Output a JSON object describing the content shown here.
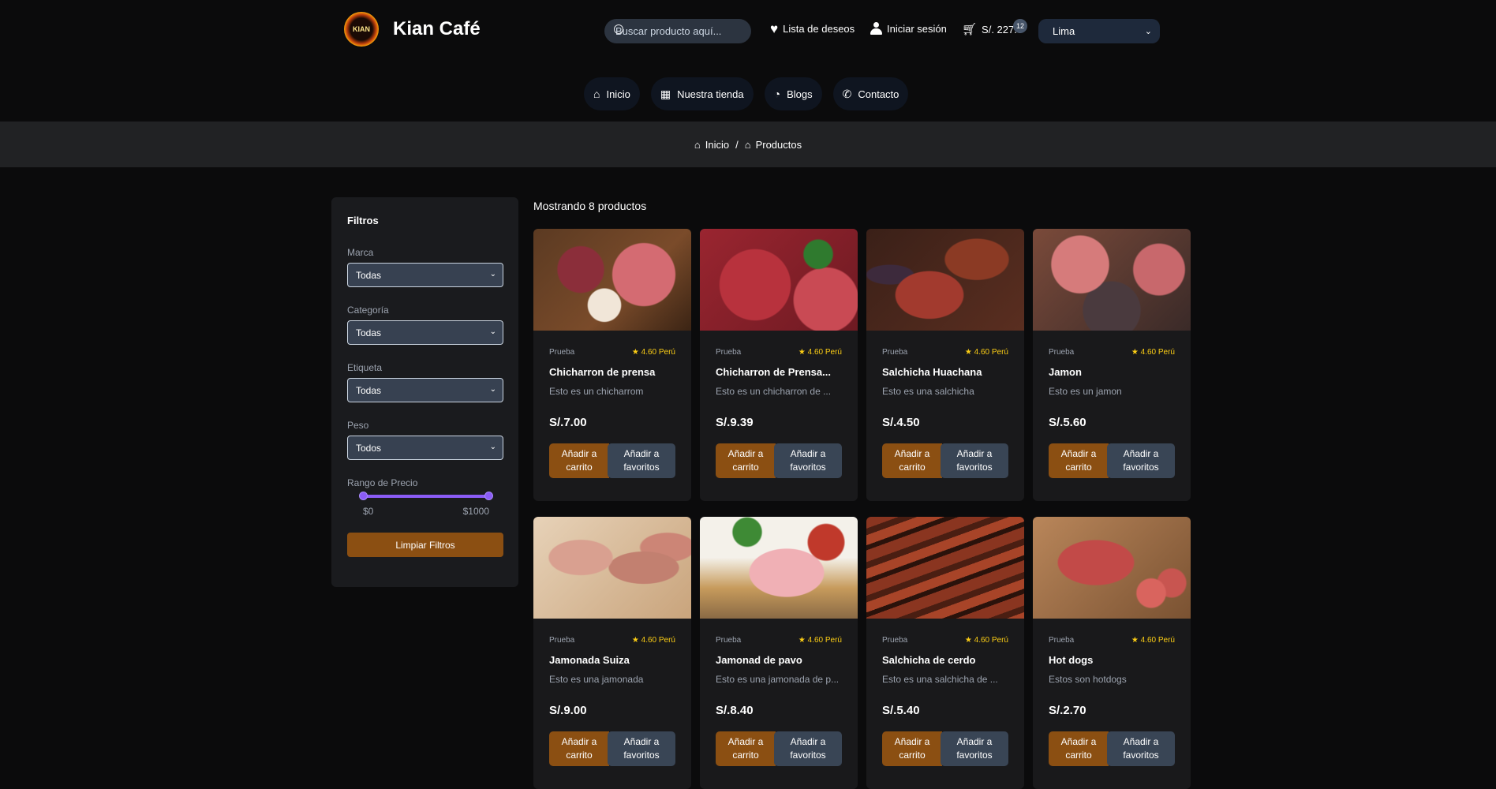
{
  "header": {
    "brand": "Kian Café",
    "logo_text": "KIAN",
    "search_placeholder": "Buscar producto aquí...",
    "wishlist_label": "Lista de deseos",
    "login_label": "Iniciar sesión",
    "cart_total": "S/. 227.0",
    "cart_count": "12",
    "city": "Lima"
  },
  "nav": {
    "items": [
      {
        "label": "Inicio",
        "icon": "home-icon"
      },
      {
        "label": "Nuestra tienda",
        "icon": "store-icon"
      },
      {
        "label": "Blogs",
        "icon": "blog-icon"
      },
      {
        "label": "Contacto",
        "icon": "phone-icon"
      }
    ]
  },
  "breadcrumb": {
    "home": "Inicio",
    "separator": "/",
    "current": "Productos"
  },
  "filters": {
    "title": "Filtros",
    "brand_label": "Marca",
    "brand_value": "Todas",
    "category_label": "Categoría",
    "category_value": "Todas",
    "tag_label": "Etiqueta",
    "tag_value": "Todas",
    "weight_label": "Peso",
    "weight_value": "Todos",
    "price_label": "Rango de Precio",
    "price_min": "$0",
    "price_max": "$1000",
    "clear_label": "Limpiar Filtros"
  },
  "products_header": "Mostrando 8 productos",
  "products": [
    {
      "brand": "Prueba",
      "rating": "★ 4.60 Perú",
      "name": "Chicharron de prensa",
      "desc": "Esto es un chicharrom",
      "price": "S/.7.00",
      "cart": "Añadir a carrito",
      "fav": "Añadir a favoritos"
    },
    {
      "brand": "Prueba",
      "rating": "★ 4.60 Perú",
      "name": "Chicharron de Prensa...",
      "desc": "Esto es un chicharron de ...",
      "price": "S/.9.39",
      "cart": "Añadir a carrito",
      "fav": "Añadir a favoritos"
    },
    {
      "brand": "Prueba",
      "rating": "★ 4.60 Perú",
      "name": "Salchicha Huachana",
      "desc": "Esto es una salchicha",
      "price": "S/.4.50",
      "cart": "Añadir a carrito",
      "fav": "Añadir a favoritos"
    },
    {
      "brand": "Prueba",
      "rating": "★ 4.60 Perú",
      "name": "Jamon",
      "desc": "Esto es un jamon",
      "price": "S/.5.60",
      "cart": "Añadir a carrito",
      "fav": "Añadir a favoritos"
    },
    {
      "brand": "Prueba",
      "rating": "★ 4.60 Perú",
      "name": "Jamonada Suiza",
      "desc": "Esto es una jamonada",
      "price": "S/.9.00",
      "cart": "Añadir a carrito",
      "fav": "Añadir a favoritos"
    },
    {
      "brand": "Prueba",
      "rating": "★ 4.60 Perú",
      "name": "Jamonad de pavo",
      "desc": "Esto es una jamonada de p...",
      "price": "S/.8.40",
      "cart": "Añadir a carrito",
      "fav": "Añadir a favoritos"
    },
    {
      "brand": "Prueba",
      "rating": "★ 4.60 Perú",
      "name": "Salchicha de cerdo",
      "desc": "Esto es una salchicha de ...",
      "price": "S/.5.40",
      "cart": "Añadir a carrito",
      "fav": "Añadir a favoritos"
    },
    {
      "brand": "Prueba",
      "rating": "★ 4.60 Perú",
      "name": "Hot dogs",
      "desc": "Estos son hotdogs",
      "price": "S/.2.70",
      "cart": "Añadir a carrito",
      "fav": "Añadir a favoritos"
    }
  ]
}
